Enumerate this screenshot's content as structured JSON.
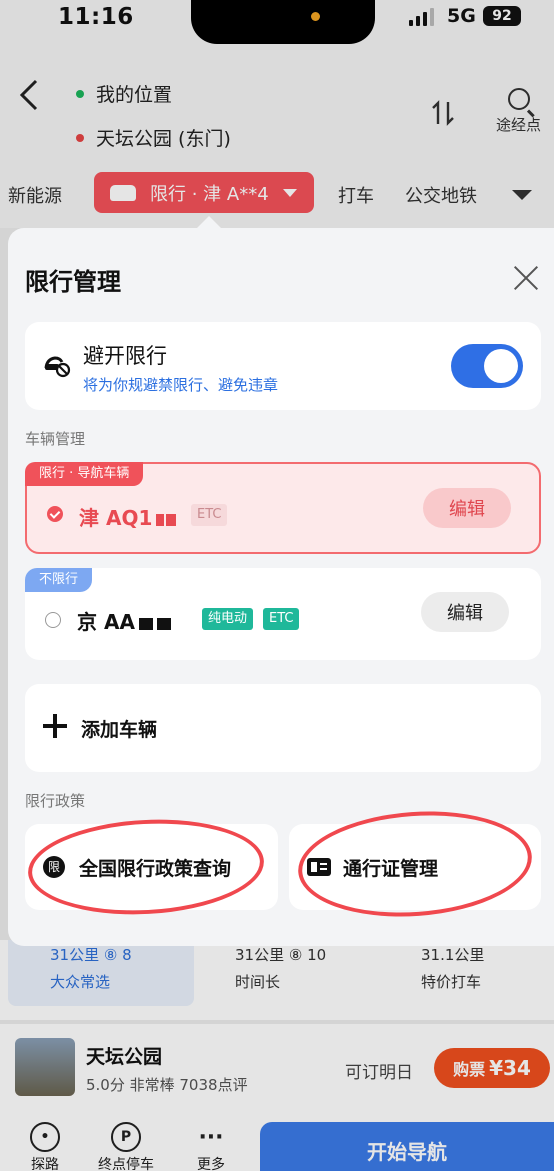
{
  "status_bar": {
    "time": "11:16",
    "network": "5G",
    "battery": "92"
  },
  "route": {
    "origin": "我的位置",
    "destination": "天坛公园 (东门)",
    "via_label": "途经点",
    "origin_color": "#1bb55c",
    "destination_color": "#e64545"
  },
  "modes": {
    "left": "新能源",
    "restrict_pill": "限行 · 津 A**4",
    "taxi": "打车",
    "transit": "公交地铁"
  },
  "sheet": {
    "title": "限行管理",
    "avoid": {
      "title": "避开限行",
      "subtitle": "将为你规避禁限行、避免违章",
      "enabled": true
    },
    "vehicle_section": "车辆管理",
    "vehicles": [
      {
        "tag": "限行 · 导航车辆",
        "plate": "津 AQ1",
        "badges": [
          "ETC"
        ],
        "edit": "编辑",
        "selected": true
      },
      {
        "tag": "不限行",
        "plate": "京 AA",
        "badges": [
          "纯电动",
          "ETC"
        ],
        "edit": "编辑",
        "selected": false
      }
    ],
    "add_vehicle": "添加车辆",
    "policy_section": "限行政策",
    "policy_query": "全国限行政策查询",
    "policy_icon_char": "限",
    "pass_manage": "通行证管理"
  },
  "bg_options": [
    {
      "line1": "31公里 ⑧ 8",
      "line2": "大众常选"
    },
    {
      "line1": "31公里 ⑧ 10",
      "line2": "时间长"
    },
    {
      "line1": "31.1公里",
      "line2": "特价打车"
    }
  ],
  "poi": {
    "name": "天坛公园",
    "meta": "5.0分 非常棒 7038点评",
    "booking": "可订明日",
    "ticket_label": "购票",
    "ticket_price": "¥34"
  },
  "bottom": {
    "explore": "探路",
    "parking": "终点停车",
    "more": "更多",
    "start": "开始导航"
  }
}
